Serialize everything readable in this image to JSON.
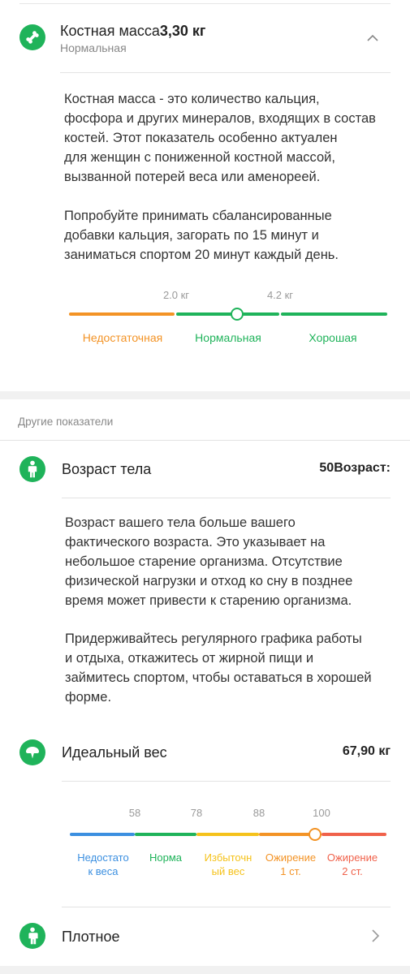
{
  "bone": {
    "title": "Костная масса",
    "value": "3,30 кг",
    "status": "Нормальная",
    "description": "Костная масса - это количество кальция,\nфосфора и других минералов, входящих в состав\nкостей. Этот показатель особенно актуален\nдля женщин с пониженной костной массой,\nвызванной потерей веса или аменореей.",
    "advice": "Попробуйте принимать сбалансированные\nдобавки кальция, загорать по 15 минут и\nзаниматься спортом 20 минут каждый день.",
    "scale": {
      "ticks": [
        "2.0 кг",
        "4.2 кг"
      ],
      "categories": [
        "Недостаточная",
        "Нормальная",
        "Хорошая"
      ],
      "colors": [
        "#f39325",
        "#1fb35a",
        "#1fb35a"
      ],
      "marker_value_kg": 3.3
    }
  },
  "other_section": {
    "label": "Другие показатели"
  },
  "body_age": {
    "title": "Возраст тела",
    "value": "50",
    "value_suffix": "Возраст:",
    "description": "Возраст вашего тела больше вашего\nфактического возраста. Это указывает на\nнебольшое старение организма. Отсутствие\nфизической нагрузки и отход ко сну в позднее\nвремя может привести к старению организма.",
    "advice": "Придерживайтесь регулярного графика работы\nи отдыха, откажитесь от жирной пищи и\nзаймитесь спортом, чтобы оставаться в хорошей\nформе."
  },
  "ideal_weight": {
    "title": "Идеальный вес",
    "value": "67,90 кг",
    "scale": {
      "ticks": [
        "58",
        "78",
        "88",
        "100"
      ],
      "categories": [
        "Недостато\nк веса",
        "Норма",
        "Избыточн\nый вес",
        "Ожирение\n1 ст.",
        "Ожирение\n2 ст."
      ],
      "colors": [
        "#3b8fe0",
        "#1fb35a",
        "#f5c21b",
        "#f39325",
        "#f0614a"
      ],
      "marker_value": 100
    }
  },
  "body_type": {
    "title": "Плотное"
  },
  "icons": {
    "bone": "bone-icon",
    "body_age": "person-icon",
    "ideal_weight": "scale-icon",
    "body_type": "person-icon",
    "chevron_up": "chevron-up-icon",
    "chevron_right": "chevron-right-icon"
  }
}
